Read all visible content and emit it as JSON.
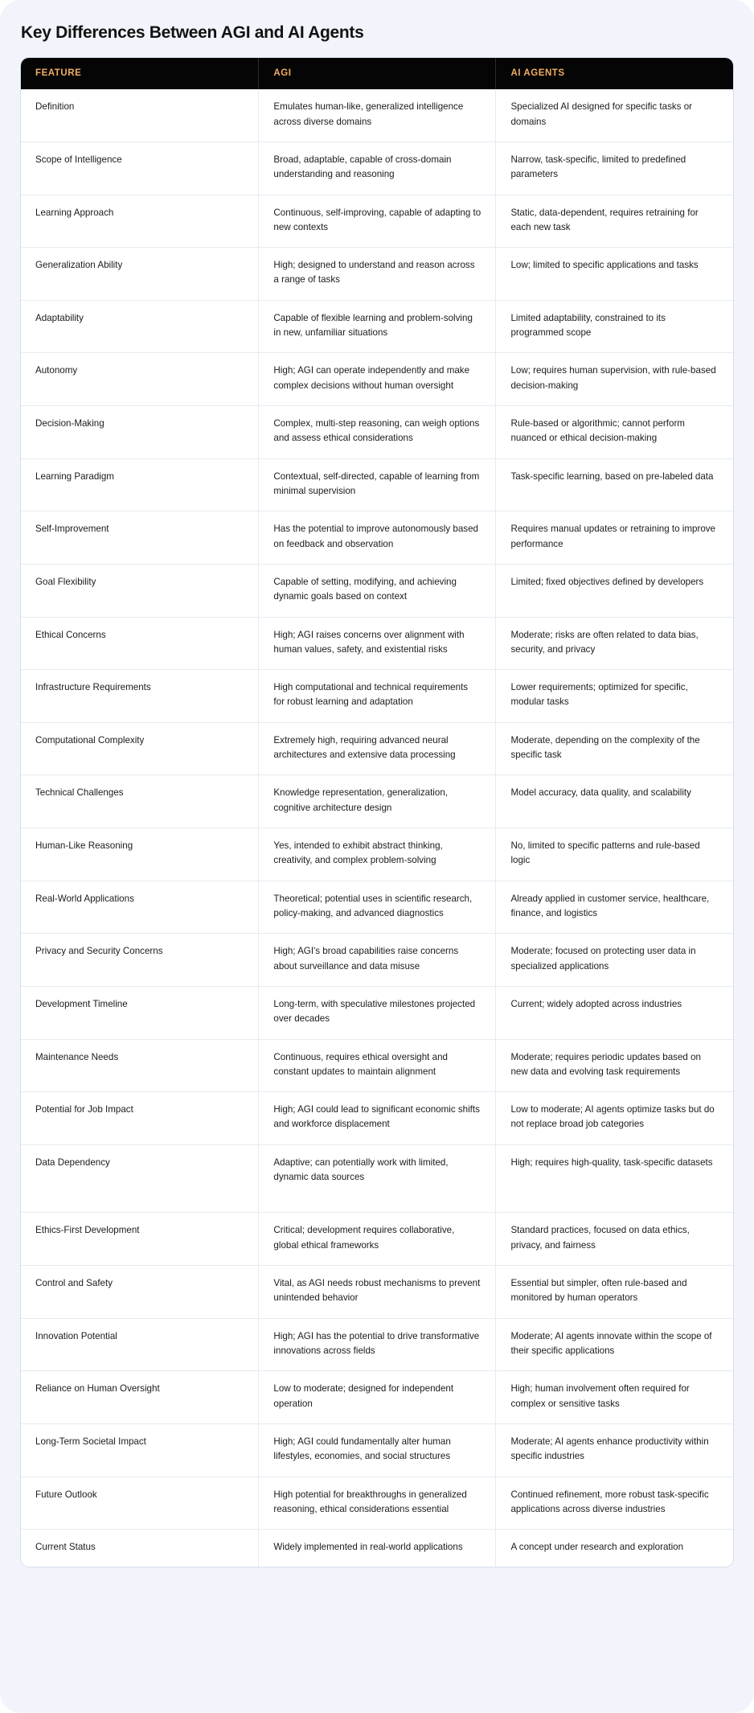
{
  "page": {
    "title": "Key Differences Between AGI and AI Agents",
    "background_color": "#f1f4fa",
    "accent_color": "#f2ad62",
    "header_background": "#050505"
  },
  "table": {
    "columns": [
      "FEATURE",
      "AGI",
      "AI AGENTS"
    ],
    "rows": [
      {
        "feature": "Definition",
        "agi": "Emulates human-like, generalized intelligence across diverse domains",
        "agents": "Specialized AI designed for specific tasks or domains",
        "tall": false
      },
      {
        "feature": "Scope of Intelligence",
        "agi": "Broad, adaptable, capable of cross-domain understanding and reasoning",
        "agents": "Narrow, task-specific, limited to predefined parameters",
        "tall": false
      },
      {
        "feature": "Learning Approach",
        "agi": "Continuous, self-improving, capable of adapting to new contexts",
        "agents": "Static, data-dependent, requires retraining for each new task",
        "tall": false
      },
      {
        "feature": "Generalization Ability",
        "agi": "High; designed to understand and reason across a range of tasks",
        "agents": "Low; limited to specific applications and tasks",
        "tall": false
      },
      {
        "feature": "Adaptability",
        "agi": "Capable of flexible learning and problem-solving in new, unfamiliar situations",
        "agents": "Limited adaptability, constrained to its programmed scope",
        "tall": false
      },
      {
        "feature": "Autonomy",
        "agi": "High; AGI can operate independently and make complex decisions without human oversight",
        "agents": "Low; requires human supervision, with rule-based decision-making",
        "tall": false
      },
      {
        "feature": "Decision-Making",
        "agi": "Complex, multi-step reasoning, can weigh options and assess ethical considerations",
        "agents": "Rule-based or algorithmic; cannot perform nuanced or ethical decision-making",
        "tall": false
      },
      {
        "feature": "Learning Paradigm",
        "agi": "Contextual, self-directed, capable of learning from minimal supervision",
        "agents": "Task-specific learning, based on pre-labeled data",
        "tall": false
      },
      {
        "feature": "Self-Improvement",
        "agi": "Has the potential to improve autonomously based on feedback and observation",
        "agents": "Requires manual updates or retraining to improve performance",
        "tall": false
      },
      {
        "feature": "Goal Flexibility",
        "agi": "Capable of setting, modifying, and achieving dynamic goals based on context",
        "agents": "Limited; fixed objectives defined by developers",
        "tall": false
      },
      {
        "feature": "Ethical Concerns",
        "agi": "High; AGI raises concerns over alignment with human values, safety, and existential risks",
        "agents": "Moderate; risks are often related to data bias, security, and privacy",
        "tall": false
      },
      {
        "feature": "Infrastructure Requirements",
        "agi": "High computational and technical requirements for robust learning and adaptation",
        "agents": "Lower requirements; optimized for specific, modular tasks",
        "tall": false
      },
      {
        "feature": "Computational Complexity",
        "agi": "Extremely high, requiring advanced neural architectures and extensive data processing",
        "agents": "Moderate, depending on the complexity of the specific task",
        "tall": false
      },
      {
        "feature": "Technical Challenges",
        "agi": "Knowledge representation, generalization, cognitive architecture design",
        "agents": "Model accuracy, data quality, and scalability",
        "tall": false
      },
      {
        "feature": "Human-Like Reasoning",
        "agi": "Yes, intended to exhibit abstract thinking, creativity, and complex problem-solving",
        "agents": "No, limited to specific patterns and rule-based logic",
        "tall": false
      },
      {
        "feature": "Real-World Applications",
        "agi": "Theoretical; potential uses in scientific research, policy-making, and advanced diagnostics",
        "agents": "Already applied in customer service, healthcare, finance, and logistics",
        "tall": false
      },
      {
        "feature": "Privacy and Security Concerns",
        "agi": "High; AGI's broad capabilities raise concerns about surveillance and data misuse",
        "agents": "Moderate; focused on protecting user data in specialized applications",
        "tall": false
      },
      {
        "feature": "Development Timeline",
        "agi": "Long-term, with speculative milestones projected over decades",
        "agents": "Current; widely adopted across industries",
        "tall": false
      },
      {
        "feature": "Maintenance Needs",
        "agi": "Continuous, requires ethical oversight and constant updates to maintain alignment",
        "agents": "Moderate; requires periodic updates based on new data and evolving task requirements",
        "tall": false
      },
      {
        "feature": "Potential for Job Impact",
        "agi": "High; AGI could lead to significant economic shifts and workforce displacement",
        "agents": "Low to moderate; AI agents optimize tasks but do not replace broad job categories",
        "tall": false
      },
      {
        "feature": "Data Dependency",
        "agi": "Adaptive; can potentially work with limited, dynamic data sources",
        "agents": "High; requires high-quality, task-specific datasets",
        "tall": true
      },
      {
        "feature": "Ethics-First Development",
        "agi": "Critical; development requires collaborative, global ethical frameworks",
        "agents": "Standard practices, focused on data ethics, privacy, and fairness",
        "tall": false
      },
      {
        "feature": "Control and Safety",
        "agi": "Vital, as AGI needs robust mechanisms to prevent unintended behavior",
        "agents": "Essential but simpler, often rule-based and monitored by human operators",
        "tall": false
      },
      {
        "feature": "Innovation Potential",
        "agi": "High; AGI has the potential to drive transformative innovations across fields",
        "agents": "Moderate; AI agents innovate within the scope of their specific applications",
        "tall": false
      },
      {
        "feature": "Reliance on Human Oversight",
        "agi": "Low to moderate; designed for independent operation",
        "agents": "High; human involvement often required for complex or sensitive tasks",
        "tall": false
      },
      {
        "feature": "Long-Term Societal Impact",
        "agi": "High; AGI could fundamentally alter human lifestyles, economies, and social structures",
        "agents": "Moderate; AI agents enhance productivity within specific industries",
        "tall": false
      },
      {
        "feature": "Future Outlook",
        "agi": "High potential for breakthroughs in generalized reasoning, ethical considerations essential",
        "agents": "Continued refinement, more robust task-specific applications across diverse industries",
        "tall": false
      },
      {
        "feature": "Current Status",
        "agi": "Widely implemented in real-world applications",
        "agents": "A concept under research and exploration",
        "tall": false
      }
    ]
  }
}
